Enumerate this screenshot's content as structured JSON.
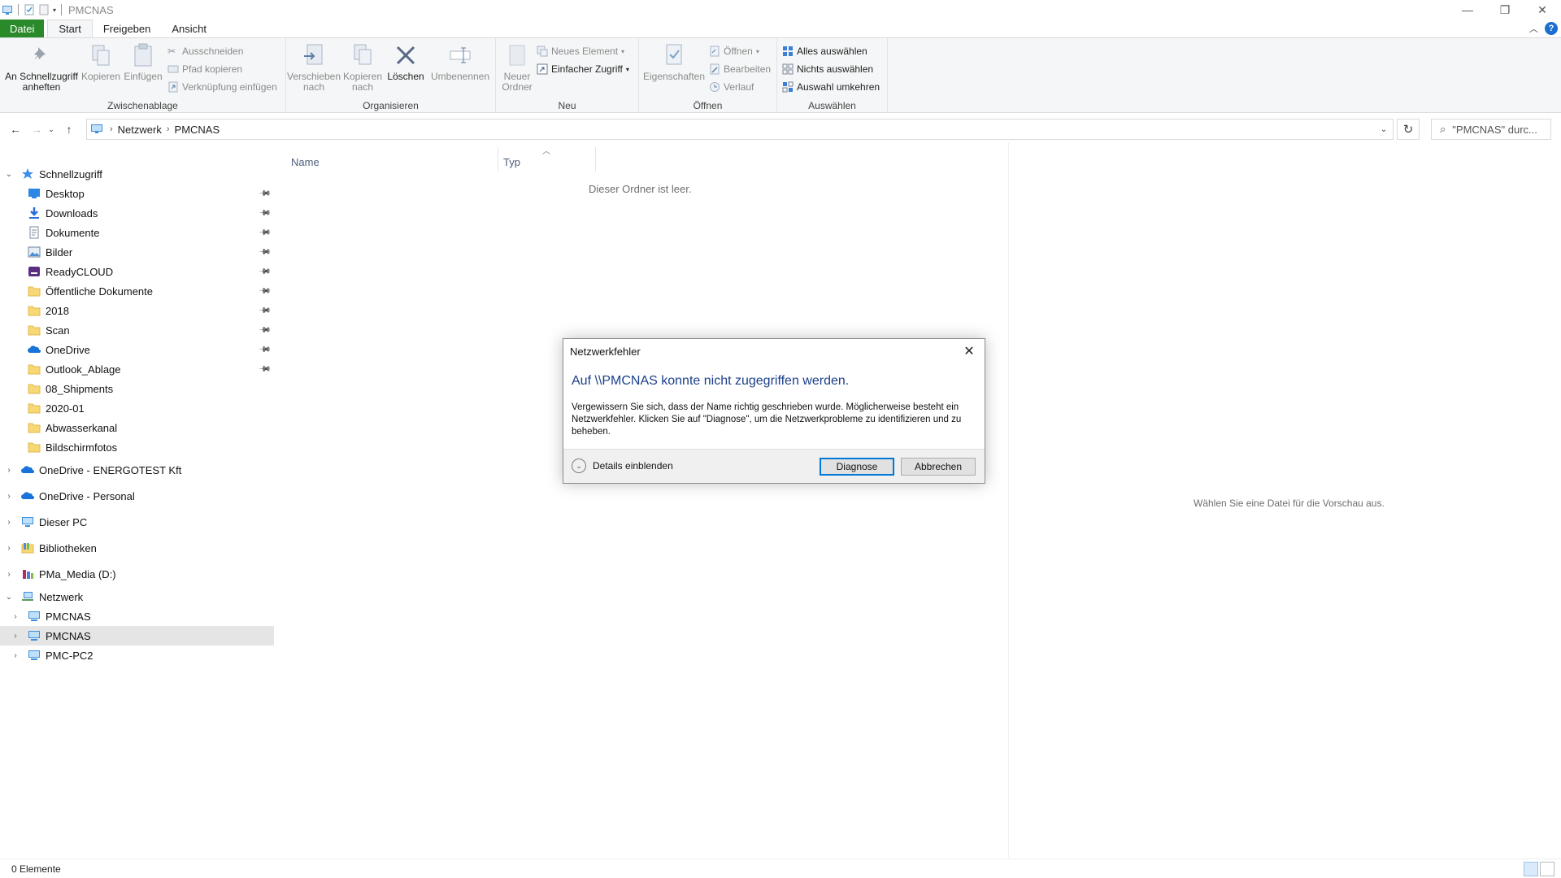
{
  "window": {
    "title": "PMCNAS",
    "controls": {
      "minimize": "—",
      "maximize": "❐",
      "close": "✕"
    }
  },
  "ribbon_tabs": [
    {
      "label": "Datei"
    },
    {
      "label": "Start"
    },
    {
      "label": "Freigeben"
    },
    {
      "label": "Ansicht"
    }
  ],
  "ribbon": {
    "clipboard": {
      "group_label": "Zwischenablage",
      "pin_label": "An Schnellzugriff anheften",
      "copy_label": "Kopieren",
      "paste_label": "Einfügen",
      "cut_label": "Ausschneiden",
      "copy_path_label": "Pfad kopieren",
      "paste_shortcut_label": "Verknüpfung einfügen"
    },
    "organize": {
      "group_label": "Organisieren",
      "move_label": "Verschieben nach",
      "copy_to_label": "Kopieren nach",
      "delete_label": "Löschen",
      "rename_label": "Umbenennen"
    },
    "new": {
      "group_label": "Neu",
      "new_folder_label": "Neuer Ordner",
      "new_item_label": "Neues Element",
      "easy_access_label": "Einfacher Zugriff"
    },
    "open": {
      "group_label": "Öffnen",
      "properties_label": "Eigenschaften",
      "open_label": "Öffnen",
      "edit_label": "Bearbeiten",
      "history_label": "Verlauf"
    },
    "select": {
      "group_label": "Auswählen",
      "select_all_label": "Alles auswählen",
      "select_none_label": "Nichts auswählen",
      "invert_label": "Auswahl umkehren"
    }
  },
  "address": {
    "segments": [
      "Netzwerk",
      "PMCNAS"
    ],
    "search_placeholder": "\"PMCNAS\" durc..."
  },
  "nav_pane": {
    "quick_access_label": "Schnellzugriff",
    "quick_items": [
      {
        "label": "Desktop",
        "icon": "desktop-icon",
        "pinned": true
      },
      {
        "label": "Downloads",
        "icon": "download-icon",
        "pinned": true
      },
      {
        "label": "Dokumente",
        "icon": "document-icon",
        "pinned": true
      },
      {
        "label": "Bilder",
        "icon": "pictures-icon",
        "pinned": true
      },
      {
        "label": "ReadyCLOUD",
        "icon": "readycloud-icon",
        "pinned": true
      },
      {
        "label": "Öffentliche Dokumente",
        "icon": "folder-icon",
        "pinned": true
      },
      {
        "label": "2018",
        "icon": "folder-icon",
        "pinned": true
      },
      {
        "label": "Scan",
        "icon": "folder-icon",
        "pinned": true
      },
      {
        "label": "OneDrive",
        "icon": "onedrive-icon",
        "pinned": true
      },
      {
        "label": "Outlook_Ablage",
        "icon": "folder-icon",
        "pinned": true
      },
      {
        "label": "08_Shipments",
        "icon": "folder-icon",
        "pinned": false
      },
      {
        "label": "2020-01",
        "icon": "folder-icon",
        "pinned": false
      },
      {
        "label": "Abwasserkanal",
        "icon": "folder-icon",
        "pinned": false
      },
      {
        "label": "Bildschirmfotos",
        "icon": "folder-icon",
        "pinned": false
      }
    ],
    "roots": [
      {
        "label": "OneDrive - ENERGOTEST Kft",
        "icon": "onedrive-icon"
      },
      {
        "label": "OneDrive - Personal",
        "icon": "onedrive-icon"
      },
      {
        "label": "Dieser PC",
        "icon": "pc-icon"
      },
      {
        "label": "Bibliotheken",
        "icon": "library-icon"
      },
      {
        "label": "PMa_Media (D:)",
        "icon": "drive-icon"
      }
    ],
    "network_label": "Netzwerk",
    "network_items": [
      {
        "label": "PMCNAS",
        "selected": false
      },
      {
        "label": "PMCNAS",
        "selected": true
      },
      {
        "label": "PMC-PC2",
        "selected": false
      }
    ]
  },
  "content": {
    "columns": [
      "Name",
      "Typ"
    ],
    "empty_text": "Dieser Ordner ist leer.",
    "preview_text": "Wählen Sie eine Datei für die Vorschau aus."
  },
  "status_bar": {
    "item_count": "0 Elemente"
  },
  "dialog": {
    "title": "Netzwerkfehler",
    "heading": "Auf \\\\PMCNAS konnte nicht zugegriffen werden.",
    "body": "Vergewissern Sie sich, dass der Name richtig geschrieben wurde. Möglicherweise besteht ein Netzwerkfehler. Klicken Sie auf \"Diagnose\", um die Netzwerkprobleme zu identifizieren und zu beheben.",
    "details_label": "Details einblenden",
    "diagnose_label": "Diagnose",
    "cancel_label": "Abbrechen"
  },
  "colors": {
    "file_tab": "#2a8a2a",
    "dialog_heading": "#1b3f8b",
    "selection": "#e5e5e5",
    "accent": "#0078d7"
  }
}
